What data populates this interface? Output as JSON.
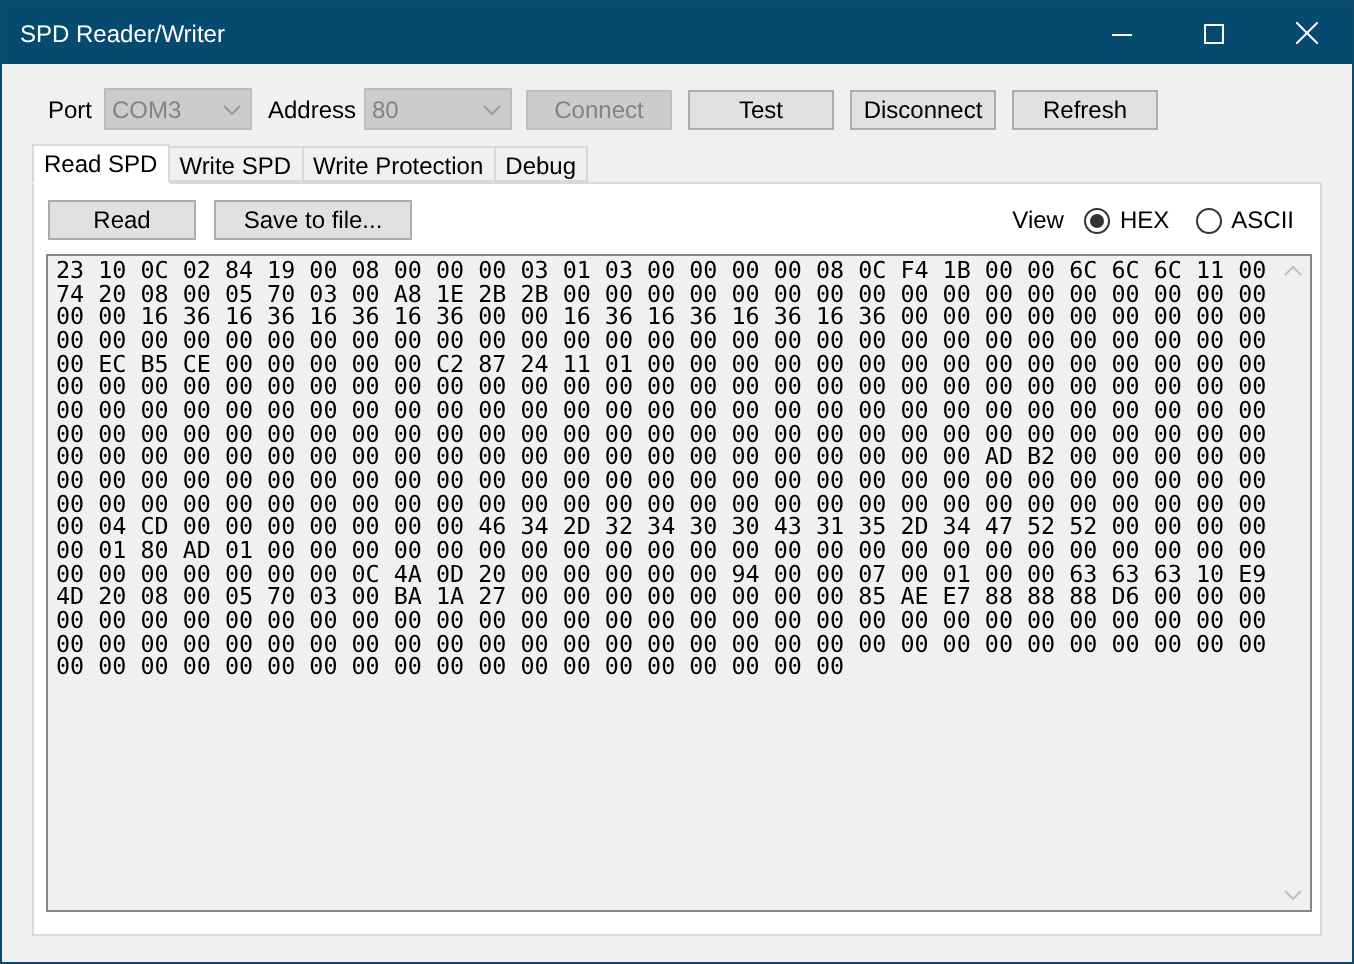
{
  "window": {
    "title": "SPD Reader/Writer"
  },
  "connection": {
    "port_label": "Port",
    "port": {
      "value": "COM3",
      "disabled": true
    },
    "address_label": "Address",
    "address": {
      "value": "80",
      "disabled": true
    },
    "buttons": [
      {
        "label": "Connect",
        "disabled": true
      },
      {
        "label": "Test",
        "disabled": false
      },
      {
        "label": "Disconnect",
        "disabled": false
      },
      {
        "label": "Refresh",
        "disabled": false
      }
    ]
  },
  "tabs": [
    {
      "label": "Read SPD",
      "selected": true
    },
    {
      "label": "Write SPD",
      "selected": false
    },
    {
      "label": "Write Protection",
      "selected": false
    },
    {
      "label": "Debug",
      "selected": false
    }
  ],
  "toolbar": {
    "buttons": [
      "Read",
      "Save to file..."
    ],
    "view_label": "View",
    "view_options": [
      {
        "label": "HEX",
        "selected": true
      },
      {
        "label": "ASCII",
        "selected": false
      }
    ]
  },
  "hex_view": {
    "lines": [
      "23 10 0C 02 84 19 00 08 00 00 00 03 01 03 00 00 00 00 08 0C F4 1B 00 00 6C 6C 6C 11 00",
      "74 20 08 00 05 70 03 00 A8 1E 2B 2B 00 00 00 00 00 00 00 00 00 00 00 00 00 00 00 00 00",
      "00 00 16 36 16 36 16 36 16 36 00 00 16 36 16 36 16 36 16 36 00 00 00 00 00 00 00 00 00",
      "00 00 00 00 00 00 00 00 00 00 00 00 00 00 00 00 00 00 00 00 00 00 00 00 00 00 00 00 00",
      "00 EC B5 CE 00 00 00 00 00 C2 87 24 11 01 00 00 00 00 00 00 00 00 00 00 00 00 00 00 00",
      "00 00 00 00 00 00 00 00 00 00 00 00 00 00 00 00 00 00 00 00 00 00 00 00 00 00 00 00 00",
      "00 00 00 00 00 00 00 00 00 00 00 00 00 00 00 00 00 00 00 00 00 00 00 00 00 00 00 00 00",
      "00 00 00 00 00 00 00 00 00 00 00 00 00 00 00 00 00 00 00 00 00 00 00 00 00 00 00 00 00",
      "00 00 00 00 00 00 00 00 00 00 00 00 00 00 00 00 00 00 00 00 00 00 AD B2 00 00 00 00 00",
      "00 00 00 00 00 00 00 00 00 00 00 00 00 00 00 00 00 00 00 00 00 00 00 00 00 00 00 00 00",
      "00 00 00 00 00 00 00 00 00 00 00 00 00 00 00 00 00 00 00 00 00 00 00 00 00 00 00 00 00",
      "00 04 CD 00 00 00 00 00 00 00 46 34 2D 32 34 30 30 43 31 35 2D 34 47 52 52 00 00 00 00",
      "00 01 80 AD 01 00 00 00 00 00 00 00 00 00 00 00 00 00 00 00 00 00 00 00 00 00 00 00 00",
      "00 00 00 00 00 00 00 0C 4A 0D 20 00 00 00 00 00 94 00 00 07 00 01 00 00 63 63 63 10 E9",
      "4D 20 08 00 05 70 03 00 BA 1A 27 00 00 00 00 00 00 00 00 85 AE E7 88 88 88 D6 00 00 00",
      "00 00 00 00 00 00 00 00 00 00 00 00 00 00 00 00 00 00 00 00 00 00 00 00 00 00 00 00 00",
      "00 00 00 00 00 00 00 00 00 00 00 00 00 00 00 00 00 00 00 00 00 00 00 00 00 00 00 00 00",
      "00 00 00 00 00 00 00 00 00 00 00 00 00 00 00 00 00 00 00"
    ]
  }
}
